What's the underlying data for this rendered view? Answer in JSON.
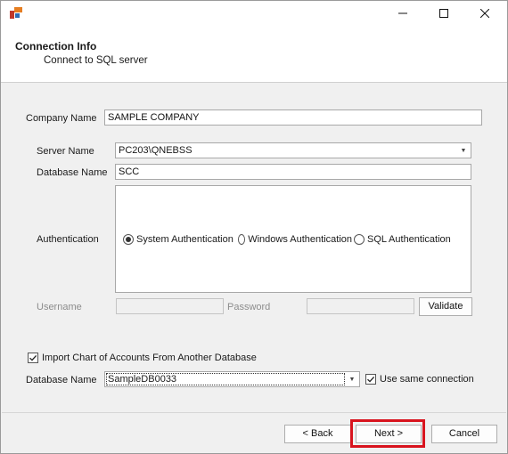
{
  "window": {
    "minimize_icon": "minimize-icon",
    "maximize_icon": "maximize-icon",
    "close_icon": "close-icon"
  },
  "header": {
    "title": "Connection Info",
    "subtitle": "Connect to SQL server"
  },
  "form": {
    "company_name": {
      "label": "Company Name",
      "value": "SAMPLE COMPANY"
    },
    "server_name": {
      "label": "Server Name",
      "value": "PC203\\QNEBSS"
    },
    "database_name": {
      "label": "Database Name",
      "value": "SCC"
    },
    "authentication": {
      "label": "Authentication",
      "options": [
        "System Authentication",
        "Windows Authentication",
        "SQL Authentication"
      ],
      "selected": "System Authentication"
    },
    "username": {
      "label": "Username",
      "value": ""
    },
    "password": {
      "label": "Password",
      "value": ""
    },
    "validate_label": "Validate"
  },
  "import": {
    "checkbox_label": "Import Chart of Accounts From Another Database",
    "checked": true,
    "database_name_label": "Database Name",
    "database_value": "SampleDB0033",
    "use_same_label": "Use same connection",
    "use_same_checked": true
  },
  "footer": {
    "back_label": "< Back",
    "next_label": "Next >",
    "cancel_label": "Cancel"
  },
  "colors": {
    "highlight": "#d8141e",
    "header_bg": "#ffffff",
    "window_bg": "#f0f0f0"
  }
}
